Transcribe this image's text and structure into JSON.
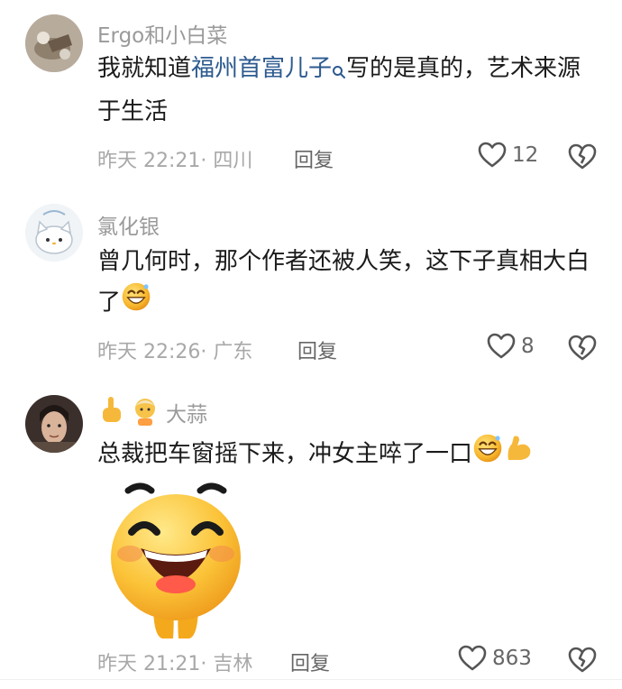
{
  "comments": [
    {
      "username": "Ergo和小白菜",
      "text_before": "我就知道",
      "link": "福州首富儿子",
      "text_after": "写的是真的，艺术来源于生活",
      "time": "昨天 22:21· 四川",
      "reply": "回复",
      "likes": "12"
    },
    {
      "username": "氯化银",
      "text": "曾几何时，那个作者还被人笑，这下子真相大白了",
      "time": "昨天 22:26· 广东",
      "reply": "回复",
      "likes": "8"
    },
    {
      "username": "大蒜",
      "text": "总裁把车窗摇下来，冲女主啐了一口",
      "time": "昨天 21:21· 吉林",
      "reply": "回复",
      "likes": "863"
    }
  ],
  "icons": [
    "search-icon",
    "heart-icon",
    "broken-heart-icon",
    "smile-emoji-icon",
    "pointing-up-icon",
    "person-icon",
    "flexed-arm-icon",
    "laughing-sticker"
  ]
}
